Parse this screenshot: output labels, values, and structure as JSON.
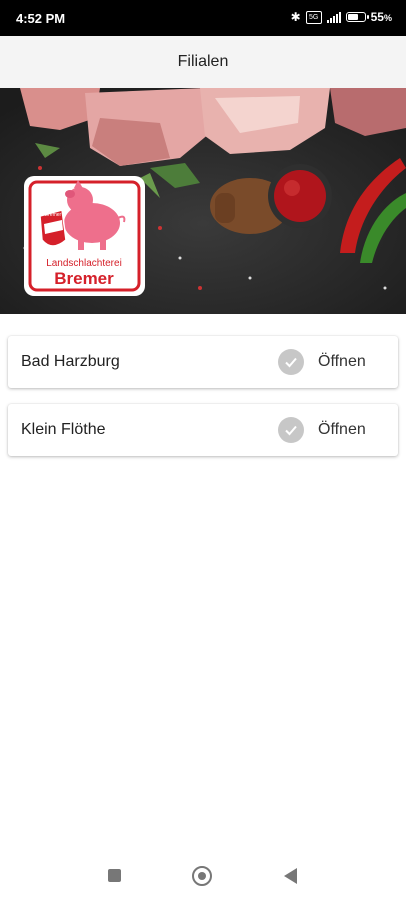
{
  "status_bar": {
    "time": "4:52 PM",
    "network_label": "5G",
    "battery_percent": "55",
    "battery_suffix": "%"
  },
  "app_bar": {
    "title": "Filialen"
  },
  "hero": {
    "logo_text_top": "Landschlachterei",
    "logo_text_bottom": "Bremer",
    "logo_shield_text": "Bremer"
  },
  "branches": [
    {
      "name": "Bad Harzburg",
      "action": "Öffnen"
    },
    {
      "name": "Klein Flöthe",
      "action": "Öffnen"
    }
  ],
  "colors": {
    "status_bar_bg": "#000000",
    "app_bar_bg": "#f4f4f4",
    "check_circle": "#c7c7c7",
    "logo_red": "#d5202a",
    "pig_pink": "#ee6f8c"
  }
}
